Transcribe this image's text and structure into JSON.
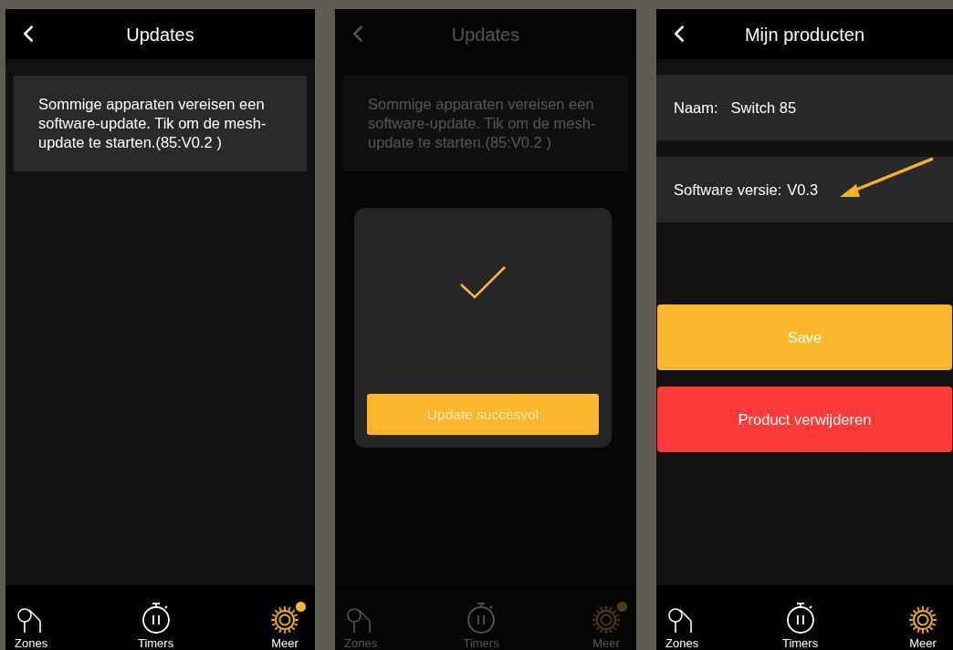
{
  "screens": [
    {
      "dimmed": false,
      "title": "Updates",
      "notice": "Sommige apparaten vereisen een software-update. Tik om de mesh-update te starten.(85:V0.2 )",
      "tabs": [
        {
          "label": "Zones",
          "selected": false,
          "badge": false
        },
        {
          "label": "Timers",
          "selected": false,
          "badge": false
        },
        {
          "label": "Meer",
          "selected": true,
          "badge": true
        }
      ]
    },
    {
      "dimmed": true,
      "title": "Updates",
      "notice": "Sommige apparaten vereisen een software-update. Tik om de mesh-update te starten.(85:V0.2 )",
      "dialog": {
        "button": "Update succesvol"
      },
      "tabs": [
        {
          "label": "Zones",
          "selected": false,
          "badge": false
        },
        {
          "label": "Timers",
          "selected": false,
          "badge": false
        },
        {
          "label": "Meer",
          "selected": true,
          "badge": true
        }
      ]
    },
    {
      "dimmed": false,
      "title": "Mijn producten",
      "fields": [
        {
          "label": "Naam:",
          "value": "Switch 85",
          "highlighted": false
        },
        {
          "label": "Software versie:",
          "value": "V0.3",
          "highlighted": true
        }
      ],
      "actions": [
        {
          "label": "Save",
          "kind": "primary"
        },
        {
          "label": "Product verwijderen",
          "kind": "danger"
        }
      ],
      "tabs": [
        {
          "label": "Zones",
          "selected": false,
          "badge": false
        },
        {
          "label": "Timers",
          "selected": false,
          "badge": false
        },
        {
          "label": "Meer",
          "selected": true,
          "badge": false
        }
      ]
    }
  ]
}
